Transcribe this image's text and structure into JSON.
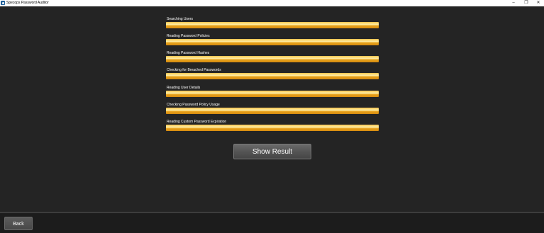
{
  "window": {
    "title": "Specops Password Auditor",
    "controls": {
      "minimize": "–",
      "maximize": "❐",
      "close": "✕"
    }
  },
  "tasks": [
    {
      "label": "Searching Users",
      "progress_percent": 100
    },
    {
      "label": "Reading Password Policies",
      "progress_percent": 100
    },
    {
      "label": "Reading Password Hashes",
      "progress_percent": 100
    },
    {
      "label": "Checking for Breached Passwords",
      "progress_percent": 100
    },
    {
      "label": "Reading User Details",
      "progress_percent": 100
    },
    {
      "label": "Checking Password Policy Usage",
      "progress_percent": 100
    },
    {
      "label": "Reading Custom Password Expiration",
      "progress_percent": 100
    }
  ],
  "buttons": {
    "show_result": "Show Result",
    "back": "Back"
  },
  "colors": {
    "background": "#242424",
    "progress_fill": "#f0b030",
    "footer": "#1c1c1c"
  }
}
